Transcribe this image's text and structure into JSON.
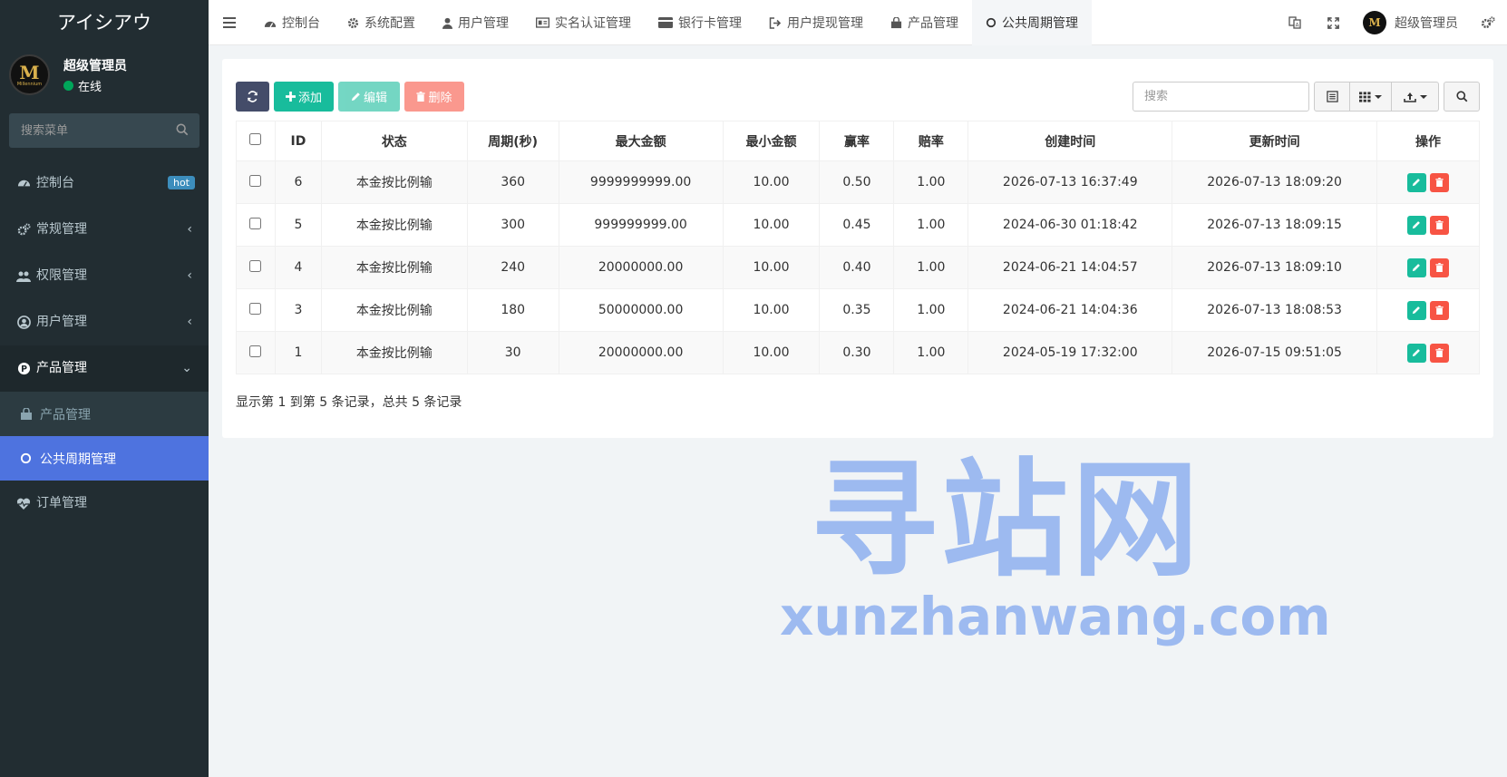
{
  "sidebar": {
    "logo": "アイシアウ",
    "user": {
      "avatar_letter": "M",
      "avatar_sub": "Millennium",
      "name": "超级管理员",
      "status": "在线"
    },
    "search_placeholder": "搜索菜单",
    "items": [
      {
        "label": "控制台",
        "icon": "dashboard-icon",
        "badge": "hot"
      },
      {
        "label": "常规管理",
        "icon": "cogs-icon",
        "chevron": "‹"
      },
      {
        "label": "权限管理",
        "icon": "group-icon",
        "chevron": "‹"
      },
      {
        "label": "用户管理",
        "icon": "user-circle-icon",
        "chevron": "‹"
      },
      {
        "label": "产品管理",
        "icon": "product-p-icon",
        "chevron": "⌄"
      }
    ],
    "subitems": [
      {
        "label": "产品管理",
        "icon": "shopping-bag-icon"
      },
      {
        "label": "公共周期管理",
        "icon": "circle-icon"
      }
    ],
    "after": {
      "label": "订单管理",
      "icon": "heartbeat-icon"
    }
  },
  "header": {
    "tabs": [
      {
        "label": "控制台",
        "icon": "dashboard-icon"
      },
      {
        "label": "系统配置",
        "icon": "cog-icon"
      },
      {
        "label": "用户管理",
        "icon": "user-icon"
      },
      {
        "label": "实名认证管理",
        "icon": "id-card-icon"
      },
      {
        "label": "银行卡管理",
        "icon": "credit-card-icon"
      },
      {
        "label": "用户提现管理",
        "icon": "sign-out-icon"
      },
      {
        "label": "产品管理",
        "icon": "shopping-bag-icon"
      },
      {
        "label": "公共周期管理",
        "icon": "circle-icon"
      }
    ],
    "user_name": "超级管理员",
    "avatar_letter": "M"
  },
  "toolbar": {
    "add": "添加",
    "edit": "编辑",
    "delete": "删除",
    "search_placeholder": "搜索"
  },
  "table": {
    "columns": [
      "ID",
      "状态",
      "周期(秒)",
      "最大金额",
      "最小金额",
      "赢率",
      "赔率",
      "创建时间",
      "更新时间",
      "操作"
    ],
    "rows": [
      {
        "id": "6",
        "status": "本金按比例输",
        "period": "360",
        "max": "9999999999.00",
        "min": "10.00",
        "win": "0.50",
        "odds": "1.00",
        "created": "2026-07-13 16:37:49",
        "updated": "2026-07-13 18:09:20"
      },
      {
        "id": "5",
        "status": "本金按比例输",
        "period": "300",
        "max": "999999999.00",
        "min": "10.00",
        "win": "0.45",
        "odds": "1.00",
        "created": "2024-06-30 01:18:42",
        "updated": "2026-07-13 18:09:15"
      },
      {
        "id": "4",
        "status": "本金按比例输",
        "period": "240",
        "max": "20000000.00",
        "min": "10.00",
        "win": "0.40",
        "odds": "1.00",
        "created": "2024-06-21 14:04:57",
        "updated": "2026-07-13 18:09:10"
      },
      {
        "id": "3",
        "status": "本金按比例输",
        "period": "180",
        "max": "50000000.00",
        "min": "10.00",
        "win": "0.35",
        "odds": "1.00",
        "created": "2024-06-21 14:04:36",
        "updated": "2026-07-13 18:08:53"
      },
      {
        "id": "1",
        "status": "本金按比例输",
        "period": "30",
        "max": "20000000.00",
        "min": "10.00",
        "win": "0.30",
        "odds": "1.00",
        "created": "2024-05-19 17:32:00",
        "updated": "2026-07-15 09:51:05"
      }
    ]
  },
  "pagination_info": "显示第 1 到第 5 条记录，总共 5 条记录",
  "watermark": {
    "title": "寻站网",
    "url": "xunzhanwang.com"
  },
  "colors": {
    "sidebar_bg": "#222d32",
    "active": "#4e73df",
    "success": "#18bc9c",
    "danger": "#f75444",
    "primary_dark": "#444c69"
  }
}
